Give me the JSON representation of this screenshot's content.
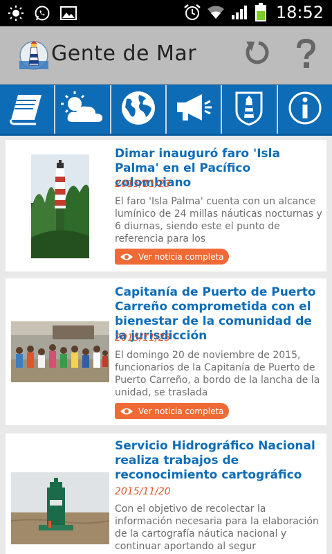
{
  "status_bar": {
    "time": "18:52",
    "left_icons": [
      "brightness-icon",
      "whatsapp-icon",
      "gallery-icon"
    ],
    "right_icons": [
      "alarm-icon",
      "wifi-icon",
      "signal-icon",
      "battery-icon"
    ]
  },
  "app": {
    "title": "Gente de Mar",
    "logo": "lighthouse-logo-icon",
    "actions": [
      "refresh-icon",
      "help-icon"
    ]
  },
  "tabs": [
    {
      "icon": "book-icon"
    },
    {
      "icon": "weather-icon"
    },
    {
      "icon": "globe-icon"
    },
    {
      "icon": "megaphone-icon"
    },
    {
      "icon": "lighthouse-shield-icon"
    },
    {
      "icon": "info-icon"
    }
  ],
  "colors": {
    "accent_blue": "#0e6cb7",
    "date_orange": "#e2542a",
    "button_orange": "#f06a35"
  },
  "news": [
    {
      "title": "Dimar inauguró faro 'Isla Palma' en el Pacífico colombiano",
      "date": "2015/11/23",
      "summary": "El faro 'Isla Palma' cuenta con un alcance lumínico de 24 millas náuticas nocturnas y 6 diurnas, siendo este el punto de referencia para los",
      "button": "Ver noticia completa"
    },
    {
      "title": "Capitanía de Puerto de Puerto Carreño comprometida con el bienestar de la comunidad de la jurisdicción",
      "date": "2015/11/23",
      "summary": "El domingo 20 de noviembre de 2015, funcionarios de la Capitanía de Puerto de Puerto Carreño, a bordo de la lancha de la unidad, se traslada",
      "button": "Ver noticia completa"
    },
    {
      "title": "Servicio Hidrográfico Nacional realiza trabajos de reconocimiento cartográfico",
      "date": "2015/11/20",
      "summary": "Con el objetivo de recolectar la información necesaria para la elaboración de la cartografía náutica nacional y continuar aportando al segur",
      "button": "Ver noticia completa"
    }
  ]
}
